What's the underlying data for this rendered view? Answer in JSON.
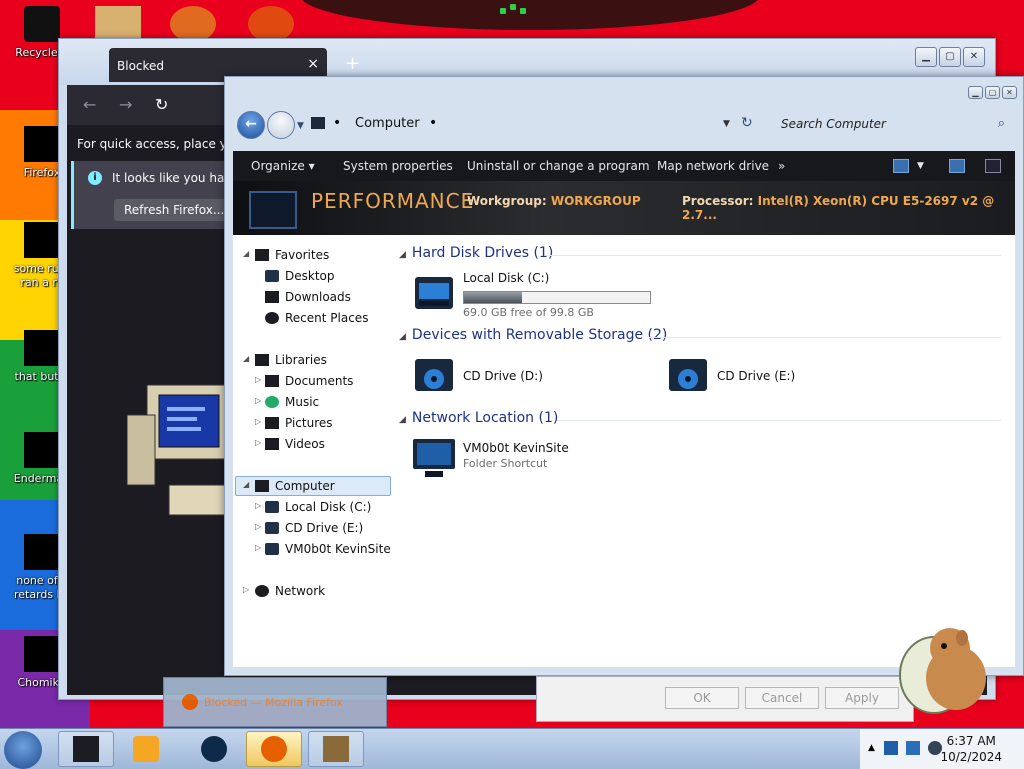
{
  "desktop": {
    "icons": [
      {
        "label": "Recycle B"
      },
      {
        "label": "Firefox"
      },
      {
        "label": "some russ ran a ra"
      },
      {
        "label": "that but it"
      },
      {
        "label": "Enderman"
      },
      {
        "label": "none of y retards kn"
      },
      {
        "label": "ChomikB"
      }
    ]
  },
  "firefox": {
    "tab_title": "Blocked",
    "tab_close": "×",
    "new_tab": "+",
    "quick_access_text": "For quick access, place your",
    "notice_text": "It looks like you haven",
    "refresh_button": "Refresh Firefox..."
  },
  "explorer": {
    "address": "Computer",
    "search_placeholder": "Search Computer",
    "toolbar": {
      "organize": "Organize ▾",
      "system_properties": "System properties",
      "uninstall": "Uninstall or change a program",
      "map_drive": "Map network drive",
      "more": "»"
    },
    "banner": {
      "title": "PERFORMANCE",
      "workgroup_label": "Workgroup:",
      "workgroup_value": "WORKGROUP",
      "processor_label": "Processor:",
      "processor_value": "Intel(R) Xeon(R) CPU E5-2697 v2 @ 2.7..."
    },
    "nav": {
      "favorites": "Favorites",
      "desktop": "Desktop",
      "downloads": "Downloads",
      "recent_places": "Recent Places",
      "libraries": "Libraries",
      "documents": "Documents",
      "music": "Music",
      "pictures": "Pictures",
      "videos": "Videos",
      "computer": "Computer",
      "local_disk": "Local Disk (C:)",
      "cd_drive": "CD Drive (E:)",
      "kevinsite": "VM0b0t KevinSite",
      "network": "Network"
    },
    "groups": {
      "hdd": "Hard Disk Drives (1)",
      "removable": "Devices with Removable Storage (2)",
      "network": "Network Location (1)"
    },
    "items": {
      "local_disk_name": "Local Disk (C:)",
      "local_disk_free": "69.0 GB free of 99.8 GB",
      "local_disk_used_fraction": 0.31,
      "cd_d": "CD Drive (D:)",
      "cd_e": "CD Drive (E:)",
      "network_name": "VM0b0t KevinSite",
      "network_sub": "Folder Shortcut"
    }
  },
  "dialog": {
    "ok": "OK",
    "cancel": "Cancel",
    "apply": "Apply"
  },
  "taskbar": {
    "preview_title": "Blocked — Mozilla Firefox",
    "time": "6:37 AM",
    "date": "10/2/2024"
  },
  "colors": {
    "desktop_red": "#e8001c",
    "banner_orange": "#f0a850",
    "group_header_blue": "#1e3287"
  }
}
